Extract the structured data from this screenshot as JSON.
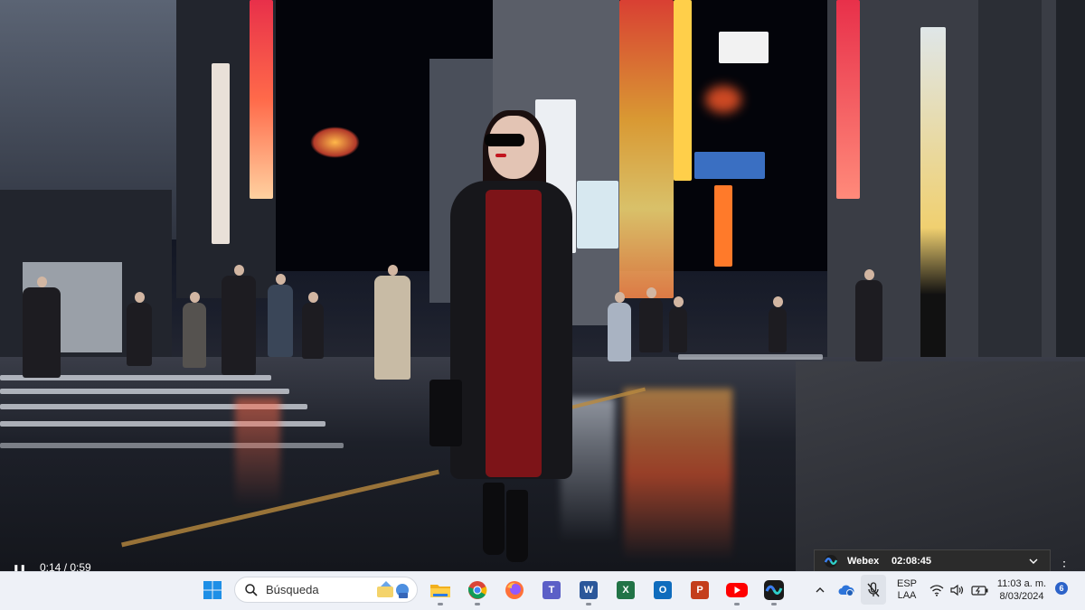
{
  "video": {
    "elapsed": "0:14 / 0:59",
    "state": "paused",
    "progress_fraction": 0.24
  },
  "webex": {
    "name": "Webex",
    "call_time": "02:08:45"
  },
  "taskbar": {
    "search_placeholder": "Búsqueda",
    "apps": [
      {
        "name": "file-explorer-icon",
        "color": "#f2b01e"
      },
      {
        "name": "chrome-icon",
        "color": "#db4437"
      },
      {
        "name": "firefox-icon",
        "color": "#ff7139"
      },
      {
        "name": "teams-icon",
        "color": "#5b5fc7",
        "letter": "T"
      },
      {
        "name": "word-icon",
        "color": "#2b579a",
        "letter": "W"
      },
      {
        "name": "excel-icon",
        "color": "#217346",
        "letter": "X"
      },
      {
        "name": "outlook-icon",
        "color": "#0f6cbd",
        "letter": "O"
      },
      {
        "name": "powerpoint-icon",
        "color": "#c43e1c",
        "letter": "P"
      },
      {
        "name": "youtube-icon",
        "color": "#ff0000"
      },
      {
        "name": "webex-icon",
        "color": "#1a1a1a"
      }
    ],
    "language": {
      "line1": "ESP",
      "line2": "LAA"
    },
    "clock": {
      "time": "11:03 a. m.",
      "date": "8/03/2024"
    },
    "notification_count": "6"
  }
}
